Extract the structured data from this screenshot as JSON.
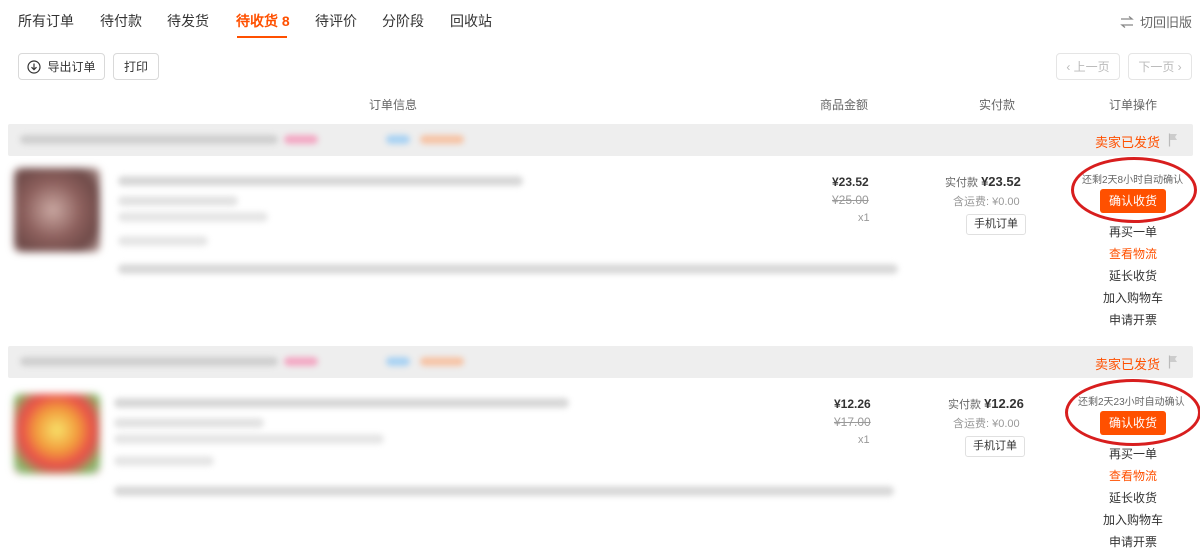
{
  "tabs": [
    {
      "label": "所有订单"
    },
    {
      "label": "待付款"
    },
    {
      "label": "待发货"
    },
    {
      "label": "待收货 8"
    },
    {
      "label": "待评价"
    },
    {
      "label": "分阶段"
    },
    {
      "label": "回收站"
    }
  ],
  "active_tab": "待收货 8",
  "old_version_label": "切回旧版",
  "toolbar": {
    "export_label": "导出订单",
    "print_label": "打印",
    "prev_page_label": "上一页",
    "next_page_label": "下一页"
  },
  "columns": {
    "order_info": "订单信息",
    "goods_amount": "商品金额",
    "paid": "实付款",
    "operations": "订单操作"
  },
  "orders": [
    {
      "status": "卖家已发货",
      "price": "¥23.52",
      "original_price": "¥25.00",
      "quantity": "x1",
      "paid_label": "实付款",
      "paid_amount": "¥23.52",
      "shipping": "含运费: ¥0.00",
      "mobile_order": "手机订单",
      "remaining": "还剩2天8小时自动确认",
      "confirm_label": "确认收货",
      "actions": [
        "再买一单",
        "查看物流",
        "延长收货",
        "加入购物车",
        "申请开票"
      ]
    },
    {
      "status": "卖家已发货",
      "price": "¥12.26",
      "original_price": "¥17.00",
      "quantity": "x1",
      "paid_label": "实付款",
      "paid_amount": "¥12.26",
      "shipping": "含运费: ¥0.00",
      "mobile_order": "手机订单",
      "remaining": "还剩2天23小时自动确认",
      "confirm_label": "确认收货",
      "actions": [
        "再买一单",
        "查看物流",
        "延长收货",
        "加入购物车",
        "申请开票"
      ]
    }
  ],
  "colors": {
    "accent": "#ff5000",
    "annotation_ring": "#d81e1e"
  }
}
